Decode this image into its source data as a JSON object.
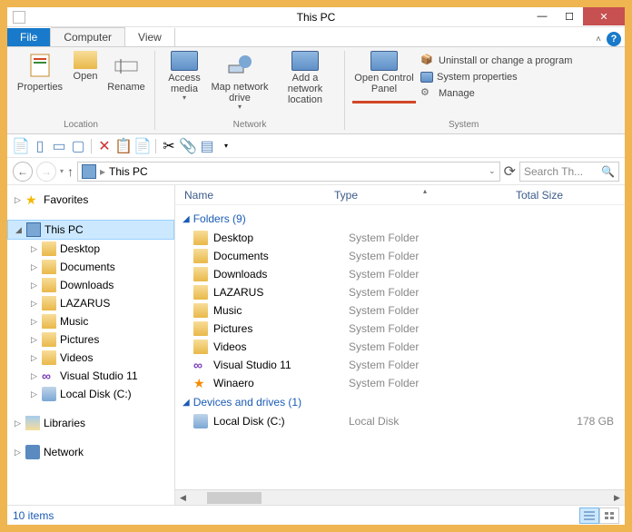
{
  "window": {
    "title": "This PC"
  },
  "tabs": {
    "file": "File",
    "computer": "Computer",
    "view": "View"
  },
  "ribbon": {
    "location": {
      "label": "Location",
      "properties": "Properties",
      "open": "Open",
      "rename": "Rename"
    },
    "network": {
      "label": "Network",
      "access_media": "Access media",
      "map_drive": "Map network drive",
      "add_location": "Add a network location"
    },
    "system": {
      "label": "System",
      "open_cp": "Open Control Panel",
      "uninstall": "Uninstall or change a program",
      "sys_props": "System properties",
      "manage": "Manage"
    }
  },
  "address": {
    "path": "This PC",
    "search_placeholder": "Search Th..."
  },
  "columns": {
    "name": "Name",
    "type": "Type",
    "size": "Total Size"
  },
  "nav": {
    "favorites": "Favorites",
    "this_pc": "This PC",
    "children": [
      {
        "label": "Desktop"
      },
      {
        "label": "Documents"
      },
      {
        "label": "Downloads"
      },
      {
        "label": "LAZARUS"
      },
      {
        "label": "Music"
      },
      {
        "label": "Pictures"
      },
      {
        "label": "Videos"
      },
      {
        "label": "Visual Studio 11"
      },
      {
        "label": "Local Disk (C:)"
      }
    ],
    "libraries": "Libraries",
    "network": "Network"
  },
  "groups": {
    "folders": {
      "header": "Folders (9)"
    },
    "devices": {
      "header": "Devices and drives (1)"
    }
  },
  "items": {
    "folders": [
      {
        "name": "Desktop",
        "type": "System Folder"
      },
      {
        "name": "Documents",
        "type": "System Folder"
      },
      {
        "name": "Downloads",
        "type": "System Folder"
      },
      {
        "name": "LAZARUS",
        "type": "System Folder"
      },
      {
        "name": "Music",
        "type": "System Folder"
      },
      {
        "name": "Pictures",
        "type": "System Folder"
      },
      {
        "name": "Videos",
        "type": "System Folder"
      },
      {
        "name": "Visual Studio 11",
        "type": "System Folder"
      },
      {
        "name": "Winaero",
        "type": "System Folder"
      }
    ],
    "drives": [
      {
        "name": "Local Disk (C:)",
        "type": "Local Disk",
        "size": "178 GB"
      }
    ]
  },
  "status": {
    "count": "10 items"
  }
}
